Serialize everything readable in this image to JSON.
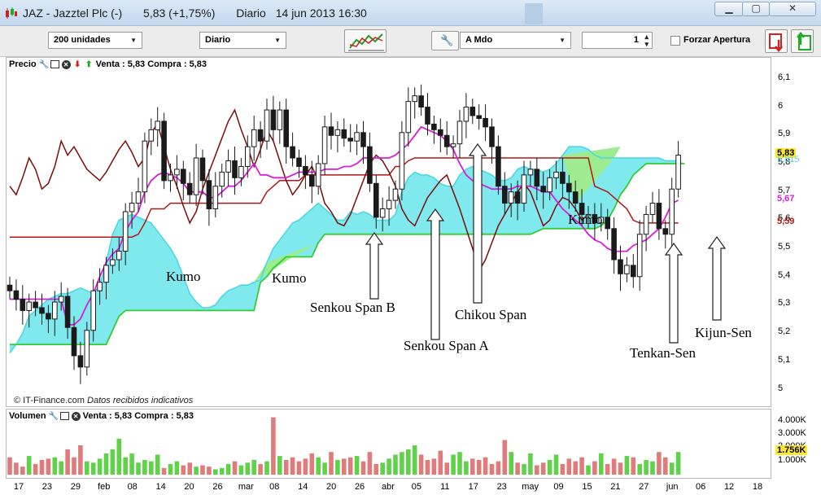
{
  "window": {
    "symbol": "JAZ",
    "name": "Jazztel Plc (-)",
    "price": "5,83 (+1,75%)",
    "period": "Diario",
    "datetime": "14 jun 2013 16:30",
    "min_icon": "minimize-icon",
    "max_icon": "maximize-icon",
    "close_icon": "close-icon"
  },
  "toolbar": {
    "units": "200 unidades",
    "interval": "Diario",
    "order_type": "A Mdo",
    "quantity": "1",
    "force_open": "Forzar Apertura"
  },
  "price_pane": {
    "title": "Precio",
    "quote": "Venta : 5,83 Compra : 5,83",
    "copyright": "© IT-Finance.com",
    "notice": "Datos recibidos indicativos",
    "last_tag": "5,83",
    "ghost_tag": "5,815",
    "tenkan_tag": "5,67",
    "kijun_tag": "5,59"
  },
  "volume_pane": {
    "title": "Volumen",
    "quote": "Venta : 5,83 Compra : 5,83",
    "last_tag": "1.756K"
  },
  "annotations": {
    "kumo1": "Kumo",
    "kumo2": "Kumo",
    "kumo3": "Kumo",
    "span_b": "Senkou Span B",
    "span_a": "Senkou Span A",
    "chikou": "Chikou Span",
    "tenkan": "Tenkan-Sen",
    "kijun": "Kijun-Sen"
  },
  "colors": {
    "kumo": "#7fe9ee",
    "kumo_edge": "#4fd6e0",
    "kumo_green": "#9dec8f",
    "span_a": "#33cc33",
    "kijun": "#b01818",
    "tenkan": "#d81ed6",
    "chikou": "#7a0c0c",
    "candle": "#1a1a1a",
    "vol_up": "#5fd24a",
    "vol_down": "#e07b7b"
  },
  "chart_data": {
    "type": "candlestick",
    "y_ticks": [
      "6,1",
      "6",
      "5,9",
      "5,8",
      "5,7",
      "5,6",
      "5,5",
      "5,4",
      "5,3",
      "5,2",
      "5,1",
      "5"
    ],
    "ylim": [
      4.97,
      6.14
    ],
    "x_ticks": [
      "17",
      "23",
      "29",
      "feb",
      "08",
      "14",
      "20",
      "26",
      "mar",
      "08",
      "14",
      "20",
      "26",
      "abr",
      "05",
      "11",
      "17",
      "23",
      "may",
      "09",
      "15",
      "21",
      "27",
      "jun",
      "06",
      "12",
      "18"
    ],
    "volume_ticks": [
      "4.000K",
      "3.000K",
      "2.000K",
      "1.000K"
    ],
    "volume_ylim": [
      0,
      4400
    ],
    "closes": [
      5.35,
      5.32,
      5.28,
      5.31,
      5.29,
      5.27,
      5.25,
      5.31,
      5.33,
      5.22,
      5.12,
      5.08,
      5.21,
      5.35,
      5.38,
      5.44,
      5.46,
      5.49,
      5.63,
      5.66,
      5.7,
      5.88,
      5.92,
      5.95,
      5.74,
      5.76,
      5.78,
      5.73,
      5.69,
      5.82,
      5.74,
      5.64,
      5.72,
      5.77,
      5.81,
      5.75,
      5.79,
      5.86,
      5.92,
      5.88,
      5.99,
      5.92,
      5.99,
      5.86,
      5.82,
      5.79,
      5.76,
      5.72,
      5.8,
      5.93,
      5.9,
      5.92,
      5.89,
      5.88,
      5.91,
      5.86,
      5.73,
      5.61,
      5.64,
      5.67,
      5.71,
      5.91,
      6.02,
      6.04,
      6.0,
      5.94,
      5.92,
      5.9,
      5.86,
      5.87,
      5.95,
      6.0,
      5.97,
      5.96,
      5.93,
      5.86,
      5.72,
      5.66,
      5.7,
      5.66,
      5.76,
      5.78,
      5.72,
      5.7,
      5.75,
      5.77,
      5.73,
      5.7,
      5.66,
      5.62,
      5.62,
      5.59,
      5.61,
      5.57,
      5.46,
      5.41,
      5.44,
      5.4,
      5.55,
      5.62,
      5.66,
      5.57,
      5.55,
      5.71,
      5.83
    ],
    "volumes": [
      1300,
      900,
      600,
      1400,
      800,
      1100,
      1200,
      1300,
      1000,
      1900,
      1300,
      2200,
      1000,
      900,
      1200,
      1600,
      1900,
      2700,
      1300,
      1600,
      900,
      1100,
      1000,
      1500,
      500,
      800,
      1000,
      700,
      900,
      600,
      700,
      600,
      400,
      500,
      800,
      1000,
      700,
      900,
      1100,
      800,
      1000,
      4300,
      1400,
      1100,
      1300,
      1000,
      1200,
      1600,
      1300,
      900,
      1700,
      1100,
      1200,
      1300,
      1400,
      1000,
      1700,
      800,
      900,
      1200,
      1500,
      1700,
      1900,
      2200,
      1500,
      1100,
      1200,
      1800,
      900,
      1500,
      1700,
      1000,
      1200,
      1100,
      1300,
      800,
      1000,
      2600,
      1700,
      900,
      800,
      1600,
      700,
      900,
      1100,
      1500,
      800,
      1200,
      1000,
      1300,
      700,
      1000,
      1600,
      800,
      1200,
      900,
      1400,
      1300,
      800,
      1100,
      1000,
      1700,
      1300,
      900,
      1700
    ],
    "span_a": [
      5.16,
      5.16,
      5.16,
      5.16,
      5.16,
      5.16,
      5.16,
      5.16,
      5.16,
      5.16,
      5.16,
      5.16,
      5.16,
      5.16,
      5.16,
      5.16,
      5.21,
      5.26,
      5.28,
      5.28,
      5.28,
      5.28,
      5.28,
      5.28,
      5.28,
      5.28,
      5.28,
      5.28,
      5.28,
      5.28,
      5.28,
      5.28,
      5.28,
      5.28,
      5.28,
      5.28,
      5.28,
      5.28,
      5.28,
      5.38,
      5.4,
      5.43,
      5.45,
      5.47,
      5.47,
      5.47,
      5.47,
      5.47,
      5.52,
      5.55,
      5.55,
      5.55,
      5.55,
      5.55,
      5.55,
      5.55,
      5.55,
      5.55,
      5.55,
      5.55,
      5.55,
      5.55,
      5.55,
      5.55,
      5.55,
      5.55,
      5.55,
      5.55,
      5.55,
      5.55,
      5.55,
      5.55,
      5.55,
      5.55,
      5.55,
      5.55,
      5.55,
      5.55,
      5.55,
      5.55,
      5.55,
      5.55,
      5.56,
      5.57,
      5.57,
      5.57,
      5.57,
      5.57,
      5.57,
      5.57,
      5.57,
      5.57,
      5.58,
      5.6,
      5.64,
      5.69,
      5.72,
      5.76,
      5.78,
      5.8,
      5.8,
      5.8,
      5.8,
      5.8,
      5.8,
      5.8
    ],
    "span_b": [
      5.13,
      5.16,
      5.2,
      5.26,
      5.28,
      5.3,
      5.32,
      5.33,
      5.34,
      5.34,
      5.35,
      5.36,
      5.35,
      5.34,
      5.37,
      5.45,
      5.55,
      5.6,
      5.61,
      5.62,
      5.61,
      5.6,
      5.59,
      5.56,
      5.53,
      5.5,
      5.46,
      5.4,
      5.34,
      5.31,
      5.29,
      5.29,
      5.3,
      5.33,
      5.35,
      5.36,
      5.37,
      5.37,
      5.38,
      5.39,
      5.45,
      5.5,
      5.53,
      5.56,
      5.59,
      5.6,
      5.62,
      5.64,
      5.66,
      5.64,
      5.62,
      5.6,
      5.6,
      5.63,
      5.62,
      5.63,
      5.62,
      5.6,
      5.6,
      5.6,
      5.62,
      5.7,
      5.75,
      5.77,
      5.76,
      5.76,
      5.75,
      5.73,
      5.72,
      5.72,
      5.76,
      5.78,
      5.79,
      5.78,
      5.77,
      5.76,
      5.74,
      5.74,
      5.75,
      5.78,
      5.79,
      5.78,
      5.78,
      5.77,
      5.78,
      5.8,
      5.83,
      5.86,
      5.86,
      5.86,
      5.85,
      5.83,
      5.82,
      5.82,
      5.82,
      5.82,
      5.82,
      5.82,
      5.82,
      5.82,
      5.82,
      5.82,
      5.81,
      5.81,
      5.81
    ],
    "kijun": [
      5.54,
      5.54,
      5.54,
      5.54,
      5.54,
      5.54,
      5.54,
      5.54,
      5.54,
      5.54,
      5.54,
      5.54,
      5.54,
      5.54,
      5.54,
      5.54,
      5.54,
      5.54,
      5.54,
      5.54,
      5.55,
      5.59,
      5.64,
      5.64,
      5.64,
      5.66,
      5.66,
      5.66,
      5.66,
      5.66,
      5.66,
      5.66,
      5.66,
      5.66,
      5.66,
      5.66,
      5.66,
      5.66,
      5.66,
      5.66,
      5.7,
      5.72,
      5.74,
      5.74,
      5.74,
      5.74,
      5.76,
      5.76,
      5.76,
      5.76,
      5.76,
      5.76,
      5.76,
      5.76,
      5.76,
      5.76,
      5.76,
      5.76,
      5.76,
      5.76,
      5.79,
      5.79,
      5.81,
      5.82,
      5.82,
      5.82,
      5.82,
      5.82,
      5.82,
      5.82,
      5.82,
      5.82,
      5.82,
      5.82,
      5.82,
      5.82,
      5.82,
      5.82,
      5.82,
      5.82,
      5.82,
      5.82,
      5.82,
      5.82,
      5.82,
      5.82,
      5.82,
      5.82,
      5.82,
      5.82,
      5.82,
      5.72,
      5.71,
      5.7,
      5.68,
      5.66,
      5.64,
      5.6,
      5.59,
      5.59,
      5.59,
      5.59,
      5.59,
      5.59,
      5.59
    ],
    "tenkan": [
      5.32,
      5.32,
      5.32,
      5.32,
      5.32,
      5.32,
      5.32,
      5.32,
      5.32,
      5.23,
      5.23,
      5.25,
      5.3,
      5.34,
      5.4,
      5.45,
      5.48,
      5.5,
      5.56,
      5.6,
      5.63,
      5.7,
      5.74,
      5.76,
      5.77,
      5.76,
      5.75,
      5.73,
      5.7,
      5.7,
      5.7,
      5.68,
      5.68,
      5.7,
      5.72,
      5.72,
      5.74,
      5.77,
      5.8,
      5.76,
      5.76,
      5.75,
      5.75,
      5.75,
      5.76,
      5.77,
      5.77,
      5.77,
      5.77,
      5.78,
      5.78,
      5.78,
      5.79,
      5.79,
      5.8,
      5.82,
      5.82,
      5.82,
      5.82,
      5.82,
      5.83,
      5.85,
      5.87,
      5.9,
      5.93,
      5.92,
      5.91,
      5.9,
      5.88,
      5.85,
      5.8,
      5.76,
      5.74,
      5.73,
      5.72,
      5.71,
      5.71,
      5.71,
      5.71,
      5.72,
      5.72,
      5.72,
      5.71,
      5.7,
      5.7,
      5.67,
      5.64,
      5.62,
      5.6,
      5.58,
      5.55,
      5.53,
      5.52,
      5.5,
      5.49,
      5.49,
      5.49,
      5.51,
      5.52,
      5.53,
      5.55,
      5.57,
      5.61,
      5.66,
      5.67
    ],
    "chikou": [
      5.72,
      5.69,
      5.75,
      5.82,
      5.78,
      5.71,
      5.73,
      5.79,
      5.88,
      5.83,
      5.86,
      5.82,
      5.78,
      5.76,
      5.74,
      5.77,
      5.81,
      5.85,
      5.88,
      5.84,
      5.79,
      5.82,
      5.91,
      5.94,
      5.86,
      5.78,
      5.72,
      5.65,
      5.59,
      5.63,
      5.71,
      5.77,
      5.83,
      5.89,
      5.95,
      5.99,
      5.92,
      5.86,
      5.79,
      5.85,
      5.92,
      5.88,
      5.81,
      5.74,
      5.69,
      5.72,
      5.76,
      5.79,
      5.74,
      5.66,
      5.63,
      5.59,
      5.58,
      5.62,
      5.68,
      5.74,
      5.8,
      5.83,
      5.81,
      5.77,
      5.72,
      5.64,
      5.6,
      5.58,
      5.63,
      5.68,
      5.71,
      5.74,
      5.76,
      5.7,
      5.64,
      5.57,
      5.5,
      5.42,
      5.46,
      5.52,
      5.58,
      5.62,
      5.66,
      5.7,
      5.73,
      5.7,
      5.64,
      5.58,
      5.6,
      5.65,
      5.68,
      5.67,
      5.64,
      5.6,
      5.62
    ]
  }
}
